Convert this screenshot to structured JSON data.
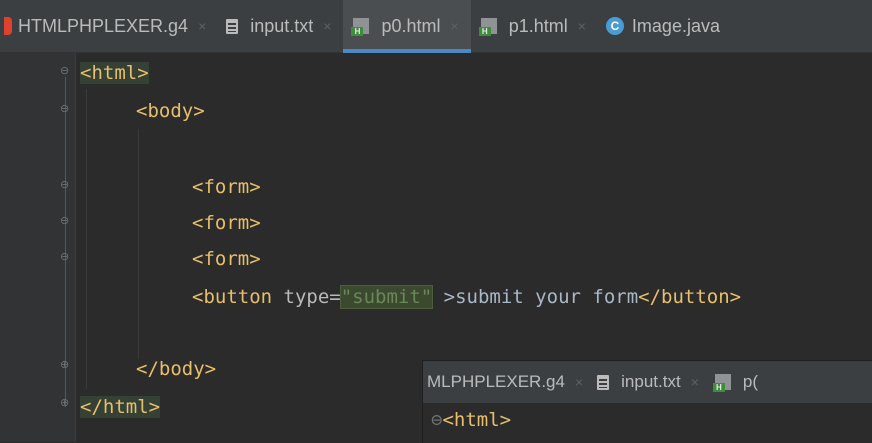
{
  "tabs": [
    {
      "label": "HTMLPHPLEXER.g4",
      "icon": "antlr-file-icon",
      "active": false
    },
    {
      "label": "input.txt",
      "icon": "text-file-icon",
      "active": false
    },
    {
      "label": "p0.html",
      "icon": "html-file-icon",
      "active": true
    },
    {
      "label": "p1.html",
      "icon": "html-file-icon",
      "active": false
    },
    {
      "label": "Image.java",
      "icon": "java-class-icon",
      "active": false
    }
  ],
  "close_glyph": "×",
  "code": {
    "l1": "<html>",
    "l2": "<body>",
    "l3": "<form>",
    "l4": "<form>",
    "l5": "<form>",
    "l6_tag_open": "<button",
    "l6_attr": " type=",
    "l6_value": "\"submit\"",
    "l6_rest": " >submit your form",
    "l6_tag_close": "</button>",
    "l7": "</body>",
    "l8": "</html>"
  },
  "popup": {
    "tabs": [
      {
        "label": "MLPHPLEXER.g4",
        "icon": "antlr-file-icon"
      },
      {
        "label": "input.txt",
        "icon": "text-file-icon"
      },
      {
        "label": "p(",
        "icon": "html-file-icon"
      }
    ],
    "code_line": "<html>"
  },
  "colors": {
    "tag": "#e8bf6a",
    "string": "#6a8759",
    "background": "#2b2b2b",
    "active_tab_underline": "#4a88c7"
  }
}
